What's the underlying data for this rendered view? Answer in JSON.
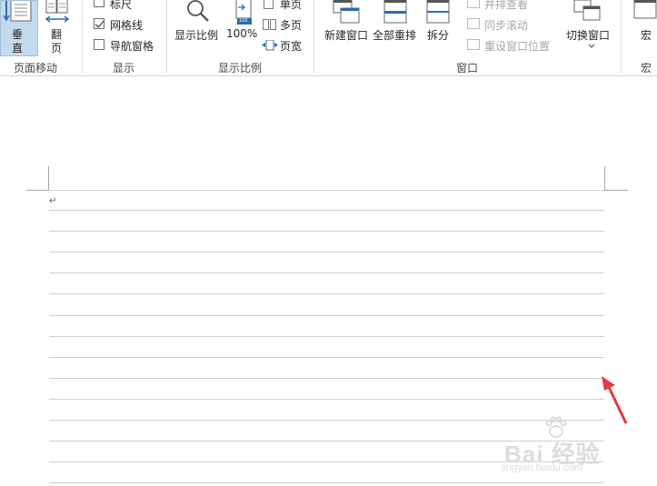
{
  "ribbon": {
    "page_movement": {
      "vertical_label_line1": "垂",
      "vertical_label_line2": "直",
      "flip_label_line1": "翻",
      "flip_label_line2": "页",
      "group_label": "页面移动"
    },
    "show": {
      "ruler_label": "标尺",
      "ruler_checked": false,
      "gridlines_label": "网格线",
      "gridlines_checked": true,
      "navpane_label": "导航窗格",
      "navpane_checked": false,
      "group_label": "显示"
    },
    "zoom": {
      "zoom_label": "显示比例",
      "zoom100_label": "100%",
      "zoom100_icon_text": "100",
      "one_page_label": "单页",
      "multi_page_label": "多页",
      "page_width_label": "页宽",
      "group_label": "显示比例"
    },
    "window": {
      "new_window_label": "新建窗口",
      "arrange_all_label": "全部重排",
      "split_label": "拆分",
      "side_by_side_label": "并排查看",
      "sync_scroll_label": "同步滚动",
      "reset_position_label": "重设窗口位置",
      "switch_windows_label": "切换窗口",
      "group_label": "窗口"
    },
    "macros": {
      "macros_label": "宏",
      "group_label": "宏"
    }
  },
  "document": {
    "paragraph_mark": "↵",
    "gridline_count": 14
  },
  "watermark": {
    "main": "Bai 经验",
    "sub": "jingyan.baidu.com"
  },
  "colors": {
    "accent_selected": "#c5d9ec",
    "icon_blue": "#2b6cb0",
    "arrow_red": "#e03c3c"
  }
}
